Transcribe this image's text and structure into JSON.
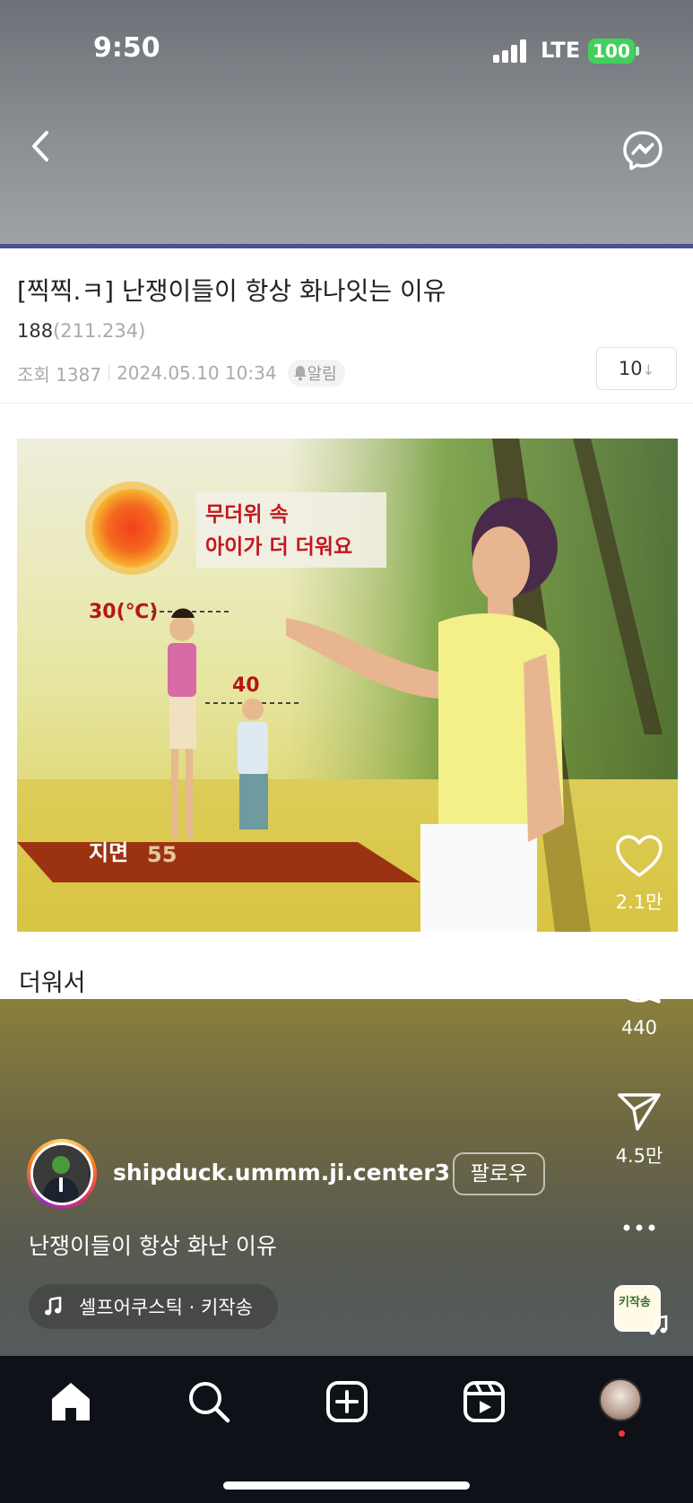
{
  "status_bar": {
    "time": "9:50",
    "network": "LTE",
    "battery": "100"
  },
  "colors": {
    "accent_line": "#4b4f8f",
    "battery_green": "#42d05b",
    "like_dot": "#ff3040"
  },
  "post": {
    "title": "[찍찍.ㅋ] 난쟁이들이 항상 화나잇는 이유",
    "author": "188",
    "author_ip": "(211.234)",
    "views": "조회 1387",
    "date": "2024.05.10 10:34",
    "alarm_label": "알림",
    "comment_count": "10",
    "body_text": "더워서",
    "image": {
      "headline_line1": "무더위 속",
      "headline_line2": "아이가 더 더워요",
      "adult_temp": "30(℃)",
      "child_temp": "40",
      "ground_label": "지면",
      "ground_temp": "55"
    }
  },
  "reel": {
    "username": "shipduck.ummm.ji.center3",
    "follow_label": "팔로우",
    "caption": "난쟁이들이 항상 화난 이유",
    "music": "셀프어쿠스틱 · 키작송",
    "audio_thumb_text": "키작송",
    "likes": "2.1만",
    "comments": "440",
    "shares": "4.5만"
  },
  "icons": {
    "back": "chevron-left-icon",
    "messenger": "messenger-icon",
    "like": "heart-icon",
    "comment": "comment-icon",
    "share": "paper-plane-icon",
    "more": "more-dots-icon",
    "nav": [
      "home-icon",
      "search-icon",
      "create-icon",
      "reels-icon",
      "profile-avatar"
    ]
  }
}
